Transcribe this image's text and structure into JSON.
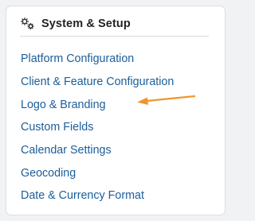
{
  "card": {
    "header": {
      "icon": "gears-icon",
      "title": "System & Setup"
    },
    "links": [
      {
        "label": "Platform Configuration"
      },
      {
        "label": "Client & Feature Configuration"
      },
      {
        "label": "Logo & Branding"
      },
      {
        "label": "Custom Fields"
      },
      {
        "label": "Calendar Settings"
      },
      {
        "label": "Geocoding"
      },
      {
        "label": "Date & Currency Format"
      }
    ]
  },
  "annotation": {
    "arrow_color": "#f0962a",
    "points_to": "Logo & Branding"
  },
  "colors": {
    "link": "#1b5e9b",
    "title": "#202326",
    "background": "#f1f2f4",
    "card": "#ffffff"
  }
}
